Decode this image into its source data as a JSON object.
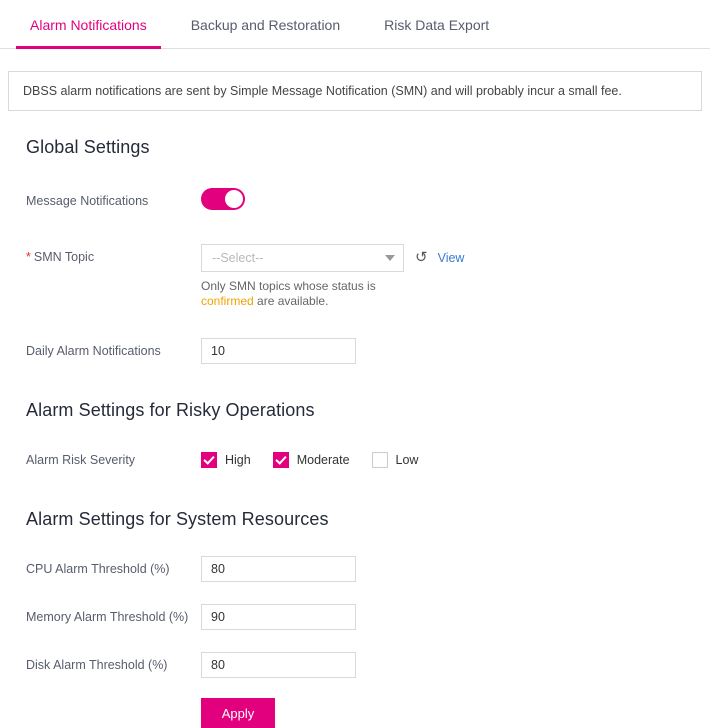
{
  "tabs": [
    {
      "label": "Alarm Notifications",
      "active": true
    },
    {
      "label": "Backup and Restoration",
      "active": false
    },
    {
      "label": "Risk Data Export",
      "active": false
    }
  ],
  "notice": {
    "text": "DBSS alarm notifications are sent by Simple Message Notification (SMN) and will probably incur a small fee."
  },
  "global_settings": {
    "title": "Global Settings",
    "message_notifications": {
      "label": "Message Notifications",
      "enabled": true
    },
    "smn_topic": {
      "label": "SMN Topic",
      "required_marker": "*",
      "selected": "--Select--",
      "refresh_icon": "↻",
      "view_link": "View",
      "hint_prefix": "Only SMN topics whose status is ",
      "hint_status": "confirmed",
      "hint_suffix": " are available."
    },
    "daily_alarm_notifications": {
      "label": "Daily Alarm Notifications",
      "value": "10"
    }
  },
  "risky_operations": {
    "title": "Alarm Settings for Risky Operations",
    "severity_label": "Alarm Risk Severity",
    "severities": [
      {
        "label": "High",
        "checked": true
      },
      {
        "label": "Moderate",
        "checked": true
      },
      {
        "label": "Low",
        "checked": false
      }
    ]
  },
  "system_resources": {
    "title": "Alarm Settings for System Resources",
    "fields": [
      {
        "label": "CPU Alarm Threshold (%)",
        "value": "80"
      },
      {
        "label": "Memory Alarm Threshold (%)",
        "value": "90"
      },
      {
        "label": "Disk Alarm Threshold (%)",
        "value": "80"
      }
    ]
  },
  "actions": {
    "apply_label": "Apply"
  },
  "colors": {
    "accent": "#e3007f",
    "link": "#3a7bd5",
    "status_warning": "#f0a202",
    "required": "#e62d2d"
  }
}
